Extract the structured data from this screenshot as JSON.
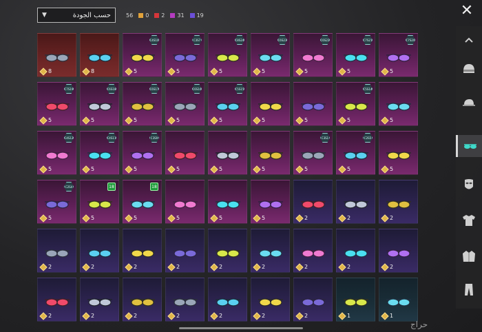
{
  "sort": {
    "label": "حسب الجودة"
  },
  "counts": [
    {
      "value": "56",
      "color": ""
    },
    {
      "value": "0",
      "color": "#e0a13a"
    },
    {
      "value": "2",
      "color": "#d6363a"
    },
    {
      "value": "31",
      "color": "#b43cc0"
    },
    {
      "value": "19",
      "color": "#6b4fd8"
    }
  ],
  "close_glyph": "✕",
  "watermark": "حراج",
  "items": [
    {
      "q": "8",
      "bg": "red",
      "badge": ""
    },
    {
      "q": "8",
      "bg": "red",
      "badge": ""
    },
    {
      "q": "5",
      "bg": "magenta",
      "badge": "C4S10"
    },
    {
      "q": "5",
      "bg": "magenta",
      "badge": "C3S7"
    },
    {
      "q": "5",
      "bg": "magenta",
      "badge": "C8S24"
    },
    {
      "q": "5",
      "bg": "magenta",
      "badge": "C6S23"
    },
    {
      "q": "5",
      "bg": "magenta",
      "badge": "C6S22"
    },
    {
      "q": "5",
      "bg": "magenta",
      "badge": "C7S21"
    },
    {
      "q": "5",
      "bg": "magenta",
      "badge": "C7S20"
    },
    {
      "q": "5",
      "bg": "magenta",
      "badge": "C7S19"
    },
    {
      "q": "5",
      "bg": "magenta",
      "badge": "C6S18"
    },
    {
      "q": "5",
      "bg": "magenta",
      "badge": "C6S17"
    },
    {
      "q": "5",
      "bg": "magenta",
      "badge": "C6S16"
    },
    {
      "q": "5",
      "bg": "magenta",
      "badge": "C5S15"
    },
    {
      "q": "5",
      "bg": "magenta",
      "badge": ""
    },
    {
      "q": "5",
      "bg": "magenta",
      "badge": ""
    },
    {
      "q": "5",
      "bg": "magenta",
      "badge": "C5S14"
    },
    {
      "q": "5",
      "bg": "magenta",
      "badge": ""
    },
    {
      "q": "5",
      "bg": "magenta",
      "badge": "C4S12"
    },
    {
      "q": "5",
      "bg": "magenta",
      "badge": "C4S11"
    },
    {
      "q": "5",
      "bg": "magenta",
      "badge": "C3S9"
    },
    {
      "q": "5",
      "bg": "magenta",
      "badge": ""
    },
    {
      "q": "5",
      "bg": "magenta",
      "badge": ""
    },
    {
      "q": "5",
      "bg": "magenta",
      "badge": ""
    },
    {
      "q": "5",
      "bg": "magenta",
      "badge": "C3S1"
    },
    {
      "q": "5",
      "bg": "magenta",
      "badge": "C2S5"
    },
    {
      "q": "5",
      "bg": "magenta",
      "badge": ""
    },
    {
      "q": "5",
      "bg": "magenta",
      "badge": "C2S4"
    },
    {
      "q": "5",
      "bg": "magenta",
      "badge": "18"
    },
    {
      "q": "5",
      "bg": "magenta",
      "badge": "18"
    },
    {
      "q": "5",
      "bg": "magenta",
      "badge": ""
    },
    {
      "q": "5",
      "bg": "magenta",
      "badge": ""
    },
    {
      "q": "5",
      "bg": "magenta",
      "badge": ""
    },
    {
      "q": "2",
      "bg": "purple",
      "badge": ""
    },
    {
      "q": "2",
      "bg": "purple",
      "badge": ""
    },
    {
      "q": "2",
      "bg": "purple",
      "badge": ""
    },
    {
      "q": "2",
      "bg": "purple",
      "badge": ""
    },
    {
      "q": "2",
      "bg": "purple",
      "badge": ""
    },
    {
      "q": "2",
      "bg": "purple",
      "badge": ""
    },
    {
      "q": "2",
      "bg": "purple",
      "badge": ""
    },
    {
      "q": "2",
      "bg": "purple",
      "badge": ""
    },
    {
      "q": "2",
      "bg": "purple",
      "badge": ""
    },
    {
      "q": "2",
      "bg": "purple",
      "badge": ""
    },
    {
      "q": "2",
      "bg": "purple",
      "badge": ""
    },
    {
      "q": "2",
      "bg": "purple",
      "badge": ""
    },
    {
      "q": "2",
      "bg": "purple",
      "badge": ""
    },
    {
      "q": "2",
      "bg": "purple",
      "badge": ""
    },
    {
      "q": "2",
      "bg": "purple",
      "badge": ""
    },
    {
      "q": "2",
      "bg": "purple",
      "badge": ""
    },
    {
      "q": "2",
      "bg": "purple",
      "badge": ""
    },
    {
      "q": "2",
      "bg": "purple",
      "badge": ""
    },
    {
      "q": "2",
      "bg": "purple",
      "badge": ""
    },
    {
      "q": "1",
      "bg": "teal",
      "badge": ""
    },
    {
      "q": "1",
      "bg": "teal",
      "badge": ""
    }
  ],
  "sidebar": [
    {
      "name": "scroll-up-icon"
    },
    {
      "name": "helmet-icon"
    },
    {
      "name": "cap-icon"
    },
    {
      "name": "glasses-icon",
      "active": true
    },
    {
      "name": "mask-icon"
    },
    {
      "name": "shirt-icon"
    },
    {
      "name": "jacket-icon"
    },
    {
      "name": "pants-icon"
    }
  ]
}
